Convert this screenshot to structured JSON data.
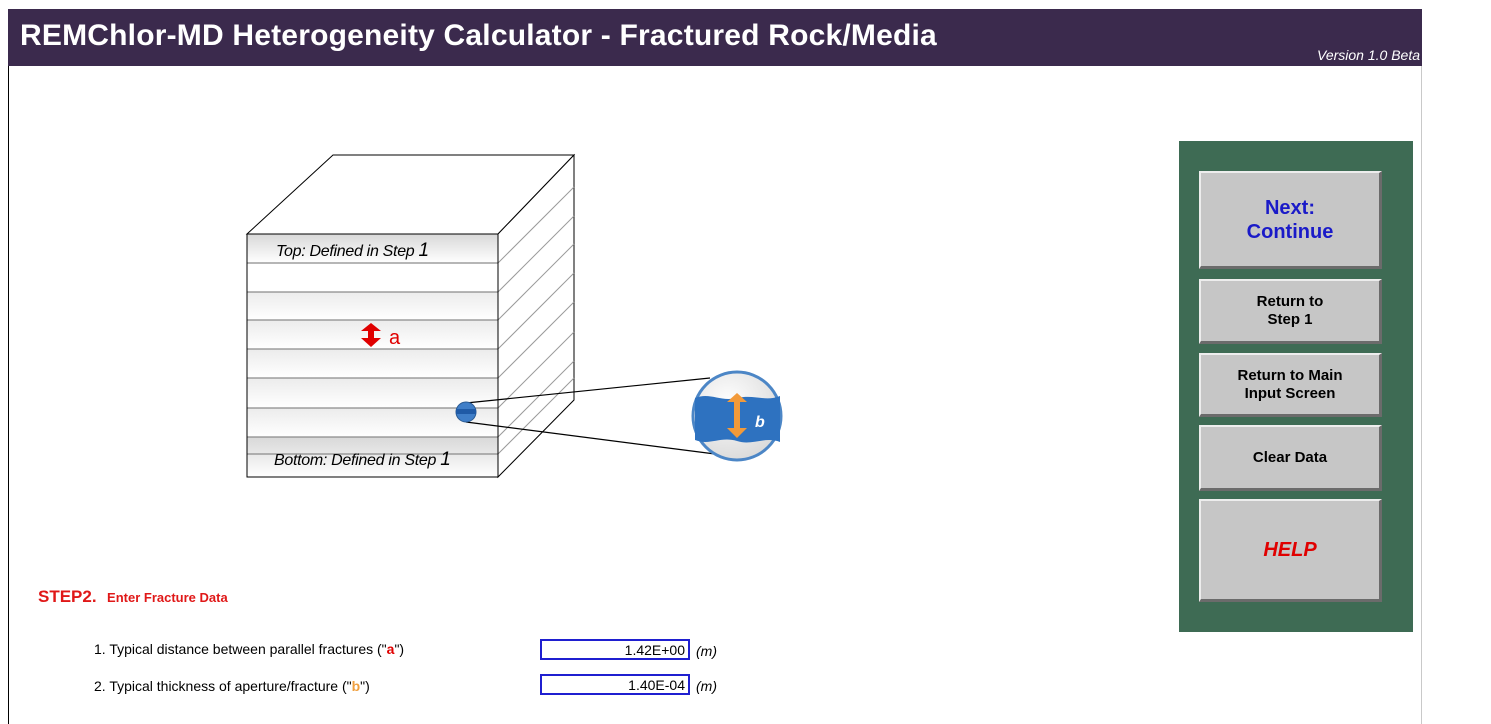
{
  "header": {
    "title": "REMChlor-MD Heterogeneity Calculator - Fractured Rock/Media",
    "version": "Version 1.0 Beta"
  },
  "diagram": {
    "top_label": "Top: Defined in Step ",
    "top_step": "1",
    "bottom_label": "Bottom: Defined in Step ",
    "bottom_step": "1",
    "spacing_label": "a",
    "aperture_label": "b"
  },
  "nav": {
    "next": "Next:\nContinue",
    "return_step1": "Return to\nStep 1",
    "return_main": "Return to Main\nInput Screen",
    "clear": "Clear Data",
    "help": "HELP"
  },
  "step": {
    "title": "STEP2.",
    "subtitle": "Enter Fracture Data"
  },
  "fields": [
    {
      "label_pre": "1.  Typical distance between parallel fractures (\"",
      "label_key": "a",
      "label_post": "\")",
      "value": "1.42E+00",
      "unit": "(m)"
    },
    {
      "label_pre": "2.  Typical thickness of aperture/fracture (\"",
      "label_key": "b",
      "label_post": "\")",
      "value": "1.40E-04",
      "unit": "(m)"
    }
  ],
  "colors": {
    "header_bg": "#3b2a4d",
    "panel_bg": "#3e6b54",
    "accent_red": "#e01818",
    "accent_orange": "#f0a040",
    "input_border": "#1f1fd0"
  }
}
